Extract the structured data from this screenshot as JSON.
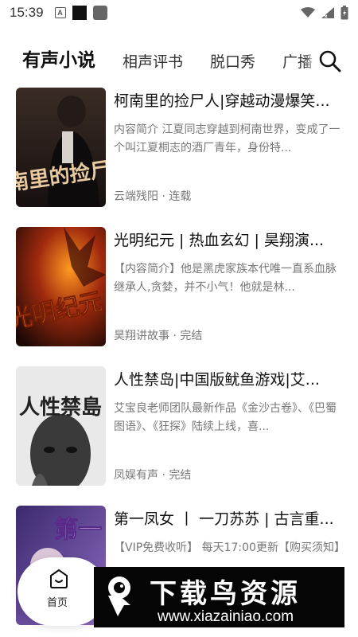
{
  "status_bar": {
    "time": "15:39",
    "a_badge": "A"
  },
  "tabs": [
    {
      "label": "有声小说",
      "active": true
    },
    {
      "label": "相声评书",
      "active": false
    },
    {
      "label": "脱口秀",
      "active": false
    },
    {
      "label": "广播",
      "active": false
    }
  ],
  "books": [
    {
      "title": "柯南里的捡尸人|穿越动漫爆笑...",
      "desc": "内容简介 江夏同志穿越到柯南世界，变成了一个叫江夏桐志的酒厂青年，身份特...",
      "author": "云端残阳",
      "status": "连载",
      "cover_text": "柯南里的捡尸人"
    },
    {
      "title": "光明纪元 | 热血玄幻 | 昊翔演...",
      "desc": "【内容简介】他是黑虎家族本代唯一直系血脉继承人,贪婪，并不小气！他就是林...",
      "author": "昊翔讲故事",
      "status": "完结",
      "cover_text": "光明纪元"
    },
    {
      "title": "人性禁岛|中国版鱿鱼游戏|艾...",
      "desc": "艾宝良老师团队最新作品《金沙古卷》、《巴蜀图语》、《狂探》陆续上线，喜...",
      "author": "凤娱有声",
      "status": "完结",
      "cover_text": "人性禁島"
    },
    {
      "title": "第一凤女 丨 一刀苏苏 | 古言重...",
      "desc": "【VIP免费收听】 每天17:00更新【购买须知】",
      "author": "",
      "status": "",
      "cover_text": "第一"
    }
  ],
  "meta_separator": "·",
  "bottom_nav": {
    "home_label": "首页"
  },
  "watermark": {
    "title": "下载鸟资源",
    "url": "www.xiazainiao.com"
  },
  "colors": {
    "text_primary": "#111111",
    "text_secondary": "#777777",
    "background": "#ffffff"
  }
}
